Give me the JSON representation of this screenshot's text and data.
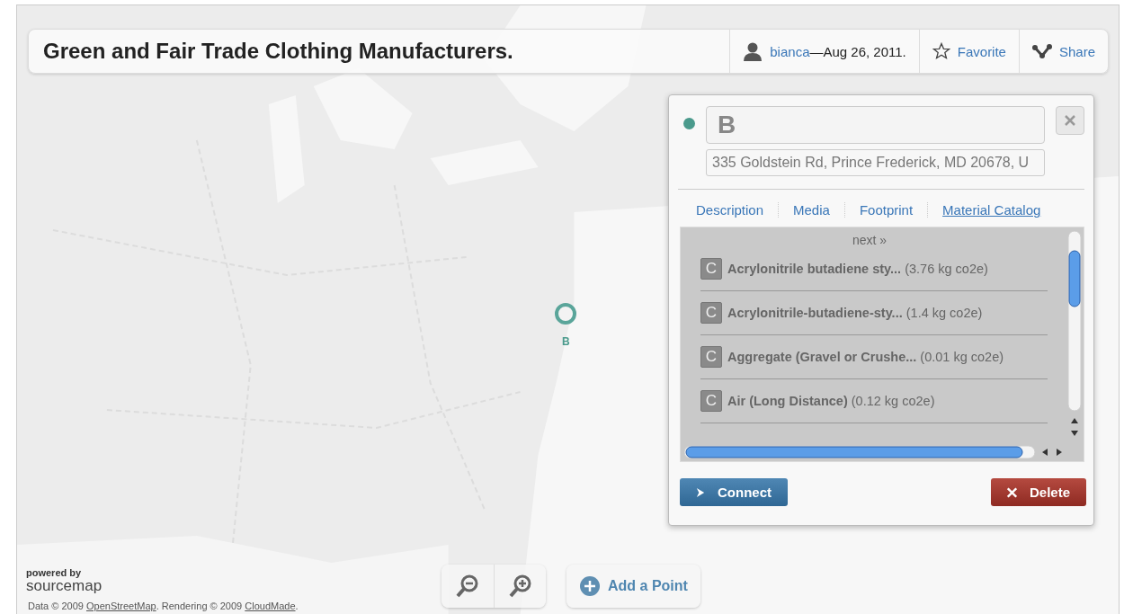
{
  "header": {
    "title": "Green and Fair Trade Clothing Manufacturers.",
    "author": "bianca",
    "date": "—Aug 26, 2011.",
    "favorite": "Favorite",
    "share": "Share"
  },
  "marker": {
    "label": "B"
  },
  "popup": {
    "color": "#4a9a8c",
    "name": "B",
    "address": "335 Goldstein Rd, Prince Frederick, MD 20678, U",
    "tabs": [
      {
        "label": "Description",
        "selected": false
      },
      {
        "label": "Media",
        "selected": false
      },
      {
        "label": "Footprint",
        "selected": false
      },
      {
        "label": "Material Catalog",
        "selected": true
      }
    ],
    "pager": "next »",
    "items": [
      {
        "badge": "C",
        "name": "Acrylonitrile butadiene sty...",
        "amount": "(3.76 kg co2e)"
      },
      {
        "badge": "C",
        "name": "Acrylonitrile-butadiene-sty...",
        "amount": "(1.4 kg co2e)"
      },
      {
        "badge": "C",
        "name": "Aggregate (Gravel or Crushe...",
        "amount": "(0.01 kg co2e)"
      },
      {
        "badge": "C",
        "name": "Air (Long Distance)",
        "amount": "(0.12 kg co2e)"
      }
    ],
    "connect": "Connect",
    "delete": "Delete"
  },
  "map_controls": {
    "add_point": "Add a Point"
  },
  "branding": {
    "powered_by": "powered by",
    "name": "sourcemap"
  },
  "attribution": [
    {
      "text": "Data © 2009 ",
      "link": false
    },
    {
      "text": "OpenStreetMap",
      "link": true
    },
    {
      "text": ". Rendering © 2009 ",
      "link": false
    },
    {
      "text": "CloudMade",
      "link": true
    },
    {
      "text": ".",
      "link": false
    }
  ]
}
